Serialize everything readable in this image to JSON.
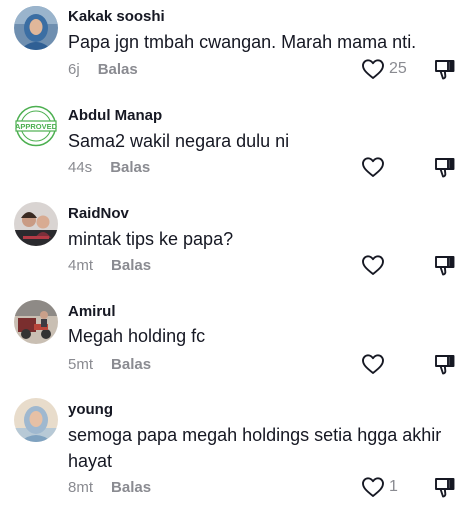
{
  "comments": [
    {
      "username": "Kakak sooshi",
      "text": "Papa jgn tmbah cwangan. Marah mama nti.",
      "time": "6j",
      "reply_label": "Balas",
      "likes": "25",
      "avatar_icon": "woman-hijab-avatar"
    },
    {
      "username": "Abdul Manap",
      "text": "Sama2 wakil negara dulu ni",
      "time": "44s",
      "reply_label": "Balas",
      "likes": "",
      "avatar_icon": "approved-stamp-avatar",
      "avatar_stamp_text": "APPROVED"
    },
    {
      "username": "RaidNov",
      "text": "mintak tips ke papa?",
      "time": "4mt",
      "reply_label": "Balas",
      "likes": "",
      "avatar_icon": "people-photo-avatar"
    },
    {
      "username": "Amirul",
      "text": "Megah holding fc",
      "time": "5mt",
      "reply_label": "Balas",
      "likes": "",
      "avatar_icon": "motorbike-photo-avatar"
    },
    {
      "username": "young",
      "text": "semoga papa megah holdings setia hgga akhir hayat",
      "time": "8mt",
      "reply_label": "Balas",
      "likes": "1",
      "avatar_icon": "woman-hijab-avatar"
    }
  ],
  "colors": {
    "text_primary": "#161823",
    "text_secondary": "#8a8b91",
    "icon": "#161823",
    "stamp_green": "#4caf50"
  }
}
